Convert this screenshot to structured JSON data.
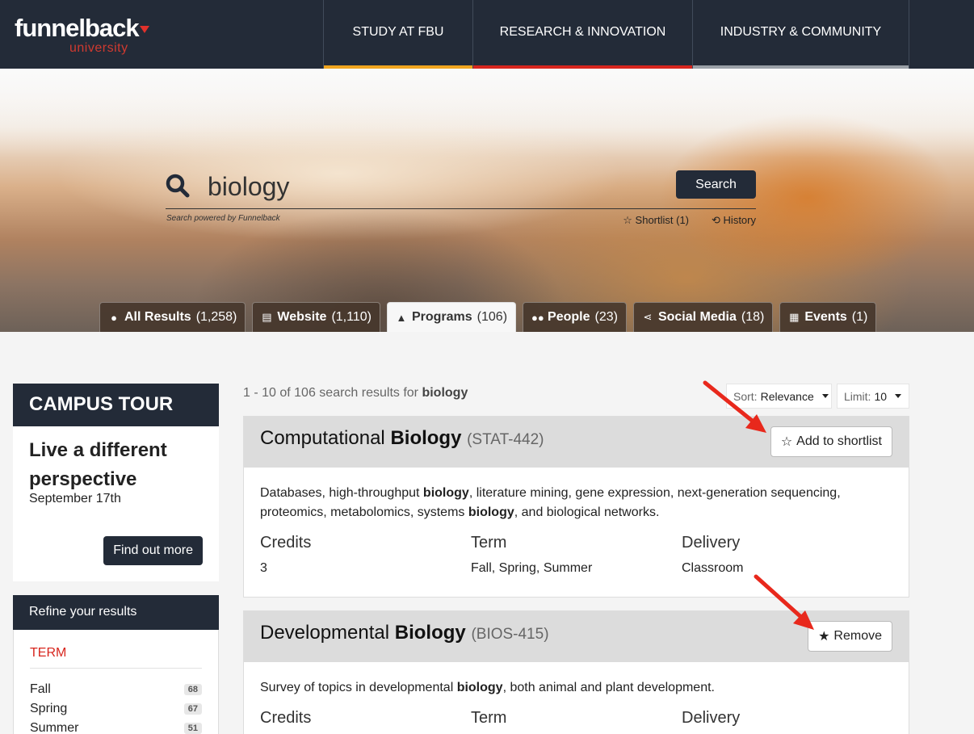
{
  "header": {
    "logo_main": "funnelback",
    "logo_sub": "university",
    "nav": [
      "STUDY AT FBU",
      "RESEARCH & INNOVATION",
      "INDUSTRY & COMMUNITY"
    ]
  },
  "search": {
    "query": "biology",
    "button_label": "Search",
    "powered_by": "Search powered by Funnelback",
    "shortlist_link": "Shortlist (1)",
    "history_link": "History"
  },
  "tabs": [
    {
      "label": "All Results",
      "count": "(1,258)",
      "icon": "globe-icon"
    },
    {
      "label": "Website",
      "count": "(1,110)",
      "icon": "document-icon"
    },
    {
      "label": "Programs",
      "count": "(106)",
      "icon": "graduation-cap-icon"
    },
    {
      "label": "People",
      "count": "(23)",
      "icon": "users-icon"
    },
    {
      "label": "Social Media",
      "count": "(18)",
      "icon": "share-icon"
    },
    {
      "label": "Events",
      "count": "(1)",
      "icon": "calendar-icon"
    }
  ],
  "campus_tour": {
    "heading": "CAMPUS TOUR",
    "title": "Live a different perspective",
    "date": "September 17th",
    "button": "Find out more"
  },
  "refine": {
    "heading": "Refine your results",
    "facet_title": "TERM",
    "items": [
      {
        "label": "Fall",
        "count": "68"
      },
      {
        "label": "Spring",
        "count": "67"
      },
      {
        "label": "Summer",
        "count": "51"
      }
    ]
  },
  "results": {
    "summary_prefix": "1 - 10 of 106 search results for",
    "summary_query": "biology",
    "sort_label": "Sort:",
    "sort_value": "Relevance",
    "limit_label": "Limit:",
    "limit_value": "10",
    "meta_labels": [
      "Credits",
      "Term",
      "Delivery"
    ],
    "items": [
      {
        "title_plain": "Computational",
        "title_bold": "Biology",
        "code": "(STAT-442)",
        "action": "Add to shortlist",
        "action_icon": "star-outline-icon",
        "desc_parts": [
          {
            "t": "Databases, high-throughput ",
            "b": false
          },
          {
            "t": "biology",
            "b": true
          },
          {
            "t": ", literature mining, gene expression, next-generation sequencing, proteomics, metabolomics, systems ",
            "b": false
          },
          {
            "t": "biology",
            "b": true
          },
          {
            "t": ", and biological networks.",
            "b": false
          }
        ],
        "credits": "3",
        "term": "Fall, Spring, Summer",
        "delivery": "Classroom"
      },
      {
        "title_plain": "Developmental",
        "title_bold": "Biology",
        "code": "(BIOS-415)",
        "action": "Remove",
        "action_icon": "star-filled-icon",
        "desc_parts": [
          {
            "t": "Survey of topics in developmental ",
            "b": false
          },
          {
            "t": "biology",
            "b": true
          },
          {
            "t": ", both animal and plant development.",
            "b": false
          }
        ]
      }
    ]
  },
  "colors": {
    "navy": "#232b38",
    "accent_red": "#d7251d",
    "accent_orange": "#f0a51e",
    "accent_gray": "#9aa0a7",
    "annotation_arrow": "#e8281c"
  }
}
